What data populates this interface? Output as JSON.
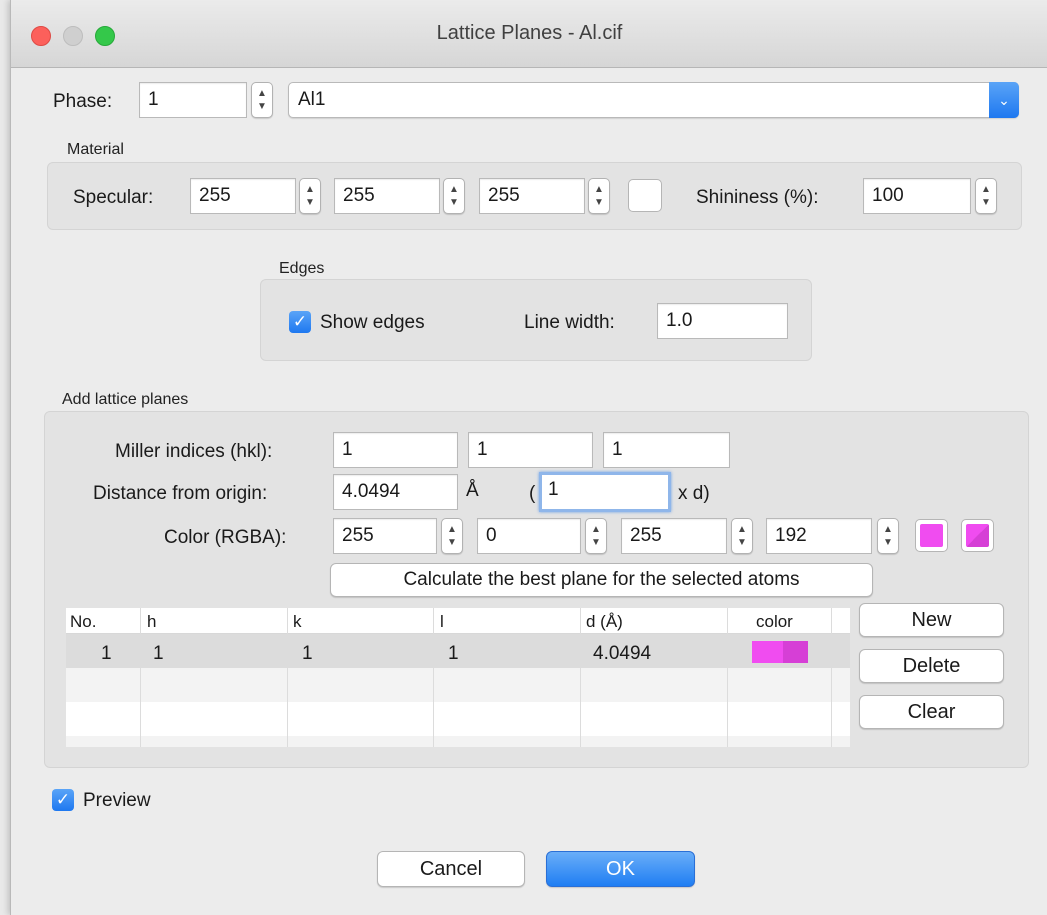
{
  "window": {
    "title": "Lattice Planes - Al.cif"
  },
  "phase": {
    "label": "Phase:",
    "number": "1",
    "selected": "Al1"
  },
  "material": {
    "title": "Material",
    "specular_label": "Specular:",
    "specular_values": [
      "255",
      "255",
      "255"
    ],
    "shininess_label": "Shininess (%):",
    "shininess_value": "100"
  },
  "edges": {
    "title": "Edges",
    "show_edges_label": "Show edges",
    "show_edges_checked": true,
    "line_width_label": "Line width:",
    "line_width_value": "1.0"
  },
  "add_planes": {
    "title": "Add lattice planes",
    "miller_label": "Miller indices (hkl):",
    "miller_values": [
      "1",
      "1",
      "1"
    ],
    "distance_label": "Distance from origin:",
    "distance_value": "4.0494",
    "angstrom": "Å",
    "paren_open": "(",
    "multiplier_value": "1",
    "times_d": "x d)",
    "color_label": "Color (RGBA):",
    "color_values": [
      "255",
      "0",
      "255",
      "192"
    ],
    "calculate_button": "Calculate the best plane for the selected atoms"
  },
  "table": {
    "headers": [
      "No.",
      "h",
      "k",
      "l",
      "d (Å)",
      "color"
    ],
    "rows": [
      {
        "no": "1",
        "h": "1",
        "k": "1",
        "l": "1",
        "d": "4.0494",
        "color": "#f04cf0"
      }
    ]
  },
  "side_buttons": {
    "new": "New",
    "delete": "Delete",
    "clear": "Clear"
  },
  "preview": {
    "label": "Preview",
    "checked": true
  },
  "footer": {
    "cancel": "Cancel",
    "ok": "OK"
  },
  "colors": {
    "accent": "#1f7ef3",
    "magenta": "#f04cf0",
    "close": "#fc605b",
    "minimize": "#d0d0d0",
    "zoom": "#34c84a"
  }
}
